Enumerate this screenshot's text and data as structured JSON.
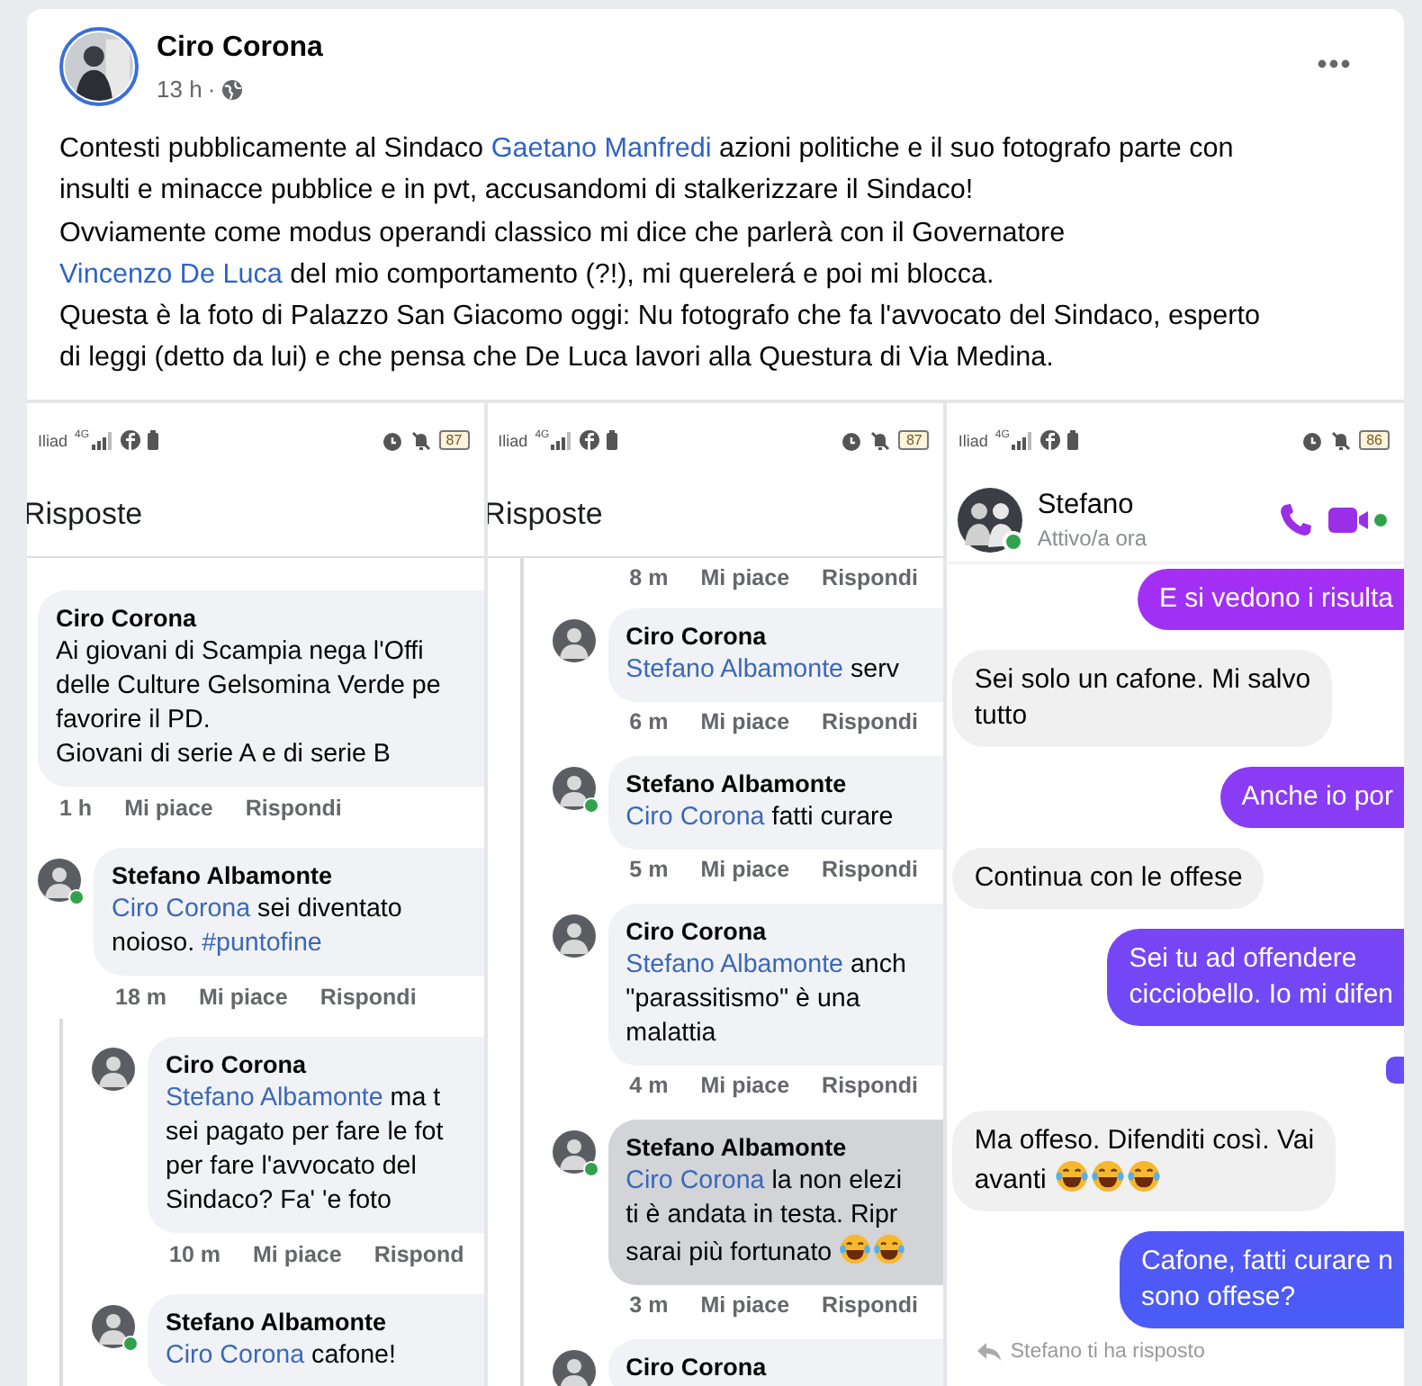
{
  "post": {
    "author": "Ciro Corona",
    "time": "13 h",
    "separator": "·",
    "body": [
      [
        {
          "kind": "plain",
          "text": "Contesti pubblicamente al Sindaco "
        },
        {
          "kind": "mention",
          "text": "Gaetano Manfredi"
        },
        {
          "kind": "plain",
          "text": " azioni politiche e il suo fotografo parte con"
        }
      ],
      [
        {
          "kind": "plain",
          "text": "insulti e minacce pubblice e in pvt, accusandomi di stalkerizzare il Sindaco!"
        }
      ],
      [
        {
          "kind": "plain",
          "text": "Ovviamente come modus operandi classico mi dice che parlerà con il Governatore"
        }
      ],
      [
        {
          "kind": "mention",
          "text": "Vincenzo De Luca"
        },
        {
          "kind": "plain",
          "text": " del mio comportamento (?!), mi querelerá e poi mi blocca."
        }
      ],
      [
        {
          "kind": "plain",
          "text": "Questa è la foto di Palazzo San Giacomo oggi: Nu fotografo che fa l'avvocato del Sindaco, esperto"
        }
      ],
      [
        {
          "kind": "plain",
          "text": "di leggi (detto da lui) e che pensa che De Luca lavori alla Questura di Via Medina."
        }
      ]
    ]
  },
  "screenshots": [
    {
      "kind": "replies",
      "status": {
        "carrier": "Iliad",
        "network": "4G",
        "battery": "87"
      },
      "title": "Risposte",
      "comments": [
        {
          "kind": "comment",
          "author": "Ciro Corona",
          "avatar": false,
          "highlighted": false,
          "lines": [
            [
              {
                "kind": "plain",
                "text": "Ai giovani di Scampia nega l'Offi"
              }
            ],
            [
              {
                "kind": "plain",
                "text": "delle Culture Gelsomina Verde pe"
              }
            ],
            [
              {
                "kind": "plain",
                "text": "favorire il PD."
              }
            ],
            [
              {
                "kind": "plain",
                "text": "Giovani di serie A e di serie B"
              }
            ]
          ],
          "time": "1 h",
          "like": "Mi piace",
          "reply": "Rispondi",
          "children": [
            {
              "kind": "comment",
              "author": "Stefano Albamonte",
              "avatar": true,
              "online": true,
              "highlighted": false,
              "lines": [
                [
                  {
                    "kind": "mention",
                    "text": "Ciro Corona"
                  },
                  {
                    "kind": "plain",
                    "text": " sei diventato"
                  }
                ],
                [
                  {
                    "kind": "plain",
                    "text": "noioso. "
                  },
                  {
                    "kind": "mention",
                    "text": "#puntofine"
                  }
                ]
              ],
              "time": "18 m",
              "like": "Mi piace",
              "reply": "Rispondi",
              "children": [
                {
                  "kind": "comment",
                  "author": "Ciro Corona",
                  "avatar": true,
                  "online": false,
                  "highlighted": false,
                  "lines": [
                    [
                      {
                        "kind": "mention",
                        "text": "Stefano Albamonte"
                      },
                      {
                        "kind": "plain",
                        "text": " ma t"
                      }
                    ],
                    [
                      {
                        "kind": "plain",
                        "text": "sei pagato per fare le fot"
                      }
                    ],
                    [
                      {
                        "kind": "plain",
                        "text": "per fare l'avvocato del"
                      }
                    ],
                    [
                      {
                        "kind": "plain",
                        "text": "Sindaco? Fa' 'e foto"
                      }
                    ]
                  ],
                  "time": "10 m",
                  "like": "Mi piace",
                  "reply": "Rispond"
                },
                {
                  "kind": "comment",
                  "author": "Stefano Albamonte",
                  "avatar": true,
                  "online": true,
                  "highlighted": false,
                  "lines": [
                    [
                      {
                        "kind": "mention",
                        "text": "Ciro Corona"
                      },
                      {
                        "kind": "plain",
                        "text": " cafone!"
                      }
                    ]
                  ]
                }
              ]
            }
          ]
        }
      ]
    },
    {
      "kind": "thread",
      "status": {
        "carrier": "Iliad",
        "network": "4G",
        "battery": "87"
      },
      "title": "Risposte",
      "comments": [
        {
          "kind": "meta",
          "time": "8 m",
          "like": "Mi piace",
          "reply": "Rispondi"
        },
        {
          "kind": "comment",
          "author": "Ciro Corona",
          "avatar": true,
          "online": false,
          "highlighted": false,
          "lines": [
            [
              {
                "kind": "mention",
                "text": "Stefano Albamonte"
              },
              {
                "kind": "plain",
                "text": " serv"
              }
            ]
          ],
          "time": "6 m",
          "like": "Mi piace",
          "reply": "Rispondi"
        },
        {
          "kind": "comment",
          "author": "Stefano Albamonte",
          "avatar": true,
          "online": true,
          "highlighted": false,
          "lines": [
            [
              {
                "kind": "mention",
                "text": "Ciro Corona"
              },
              {
                "kind": "plain",
                "text": " fatti curare"
              }
            ]
          ],
          "time": "5 m",
          "like": "Mi piace",
          "reply": "Rispondi"
        },
        {
          "kind": "comment",
          "author": "Ciro Corona",
          "avatar": true,
          "online": false,
          "highlighted": false,
          "lines": [
            [
              {
                "kind": "mention",
                "text": "Stefano Albamonte"
              },
              {
                "kind": "plain",
                "text": " anch"
              }
            ],
            [
              {
                "kind": "plain",
                "text": "\"parassitismo\" è una"
              }
            ],
            [
              {
                "kind": "plain",
                "text": "malattia"
              }
            ]
          ],
          "time": "4 m",
          "like": "Mi piace",
          "reply": "Rispondi"
        },
        {
          "kind": "comment",
          "author": "Stefano Albamonte",
          "avatar": true,
          "online": true,
          "highlighted": true,
          "lines": [
            [
              {
                "kind": "mention",
                "text": "Ciro Corona"
              },
              {
                "kind": "plain",
                "text": " la non elezi"
              }
            ],
            [
              {
                "kind": "plain",
                "text": "ti è andata in testa. Ripr"
              }
            ],
            [
              {
                "kind": "plain",
                "text": "sarai più fortunato "
              },
              {
                "kind": "emoji"
              },
              {
                "kind": "emoji"
              }
            ]
          ],
          "time": "3 m",
          "like": "Mi piace",
          "reply": "Rispondi"
        },
        {
          "kind": "comment",
          "author": "Ciro Corona",
          "avatar": true,
          "online": false,
          "highlighted": false
        }
      ]
    },
    {
      "kind": "chat",
      "status": {
        "carrier": "Iliad",
        "network": "4G",
        "battery": "86"
      },
      "contact": {
        "name": "Stefano",
        "presence": "Attivo/a ora",
        "online": true
      },
      "messages": [
        {
          "kind": "sent",
          "lines": [
            [
              {
                "kind": "plain",
                "text": "E si vedono i risulta"
              }
            ]
          ]
        },
        {
          "kind": "received",
          "lines": [
            [
              {
                "kind": "plain",
                "text": "Sei solo un cafone. Mi salvo"
              }
            ],
            [
              {
                "kind": "plain",
                "text": "tutto"
              }
            ]
          ]
        },
        {
          "kind": "sent",
          "lines": [
            [
              {
                "kind": "plain",
                "text": "Anche io por"
              }
            ]
          ]
        },
        {
          "kind": "received",
          "lines": [
            [
              {
                "kind": "plain",
                "text": "Continua con le offese"
              }
            ]
          ]
        },
        {
          "kind": "sent",
          "lines": [
            [
              {
                "kind": "plain",
                "text": "Sei tu ad offendere"
              }
            ],
            [
              {
                "kind": "plain",
                "text": "cicciobello. Io mi difen"
              }
            ]
          ]
        },
        {
          "kind": "blip"
        },
        {
          "kind": "received",
          "lines": [
            [
              {
                "kind": "plain",
                "text": "Ma offeso. Difenditi così. Vai"
              }
            ],
            [
              {
                "kind": "plain",
                "text": "avanti "
              },
              {
                "kind": "emoji"
              },
              {
                "kind": "emoji"
              },
              {
                "kind": "emoji"
              }
            ]
          ]
        },
        {
          "kind": "sent",
          "lines": [
            [
              {
                "kind": "plain",
                "text": "Cafone, fatti curare n"
              }
            ],
            [
              {
                "kind": "plain",
                "text": "sono offese?"
              }
            ]
          ]
        }
      ],
      "reply_note": "Stefano ti ha risposto"
    }
  ]
}
